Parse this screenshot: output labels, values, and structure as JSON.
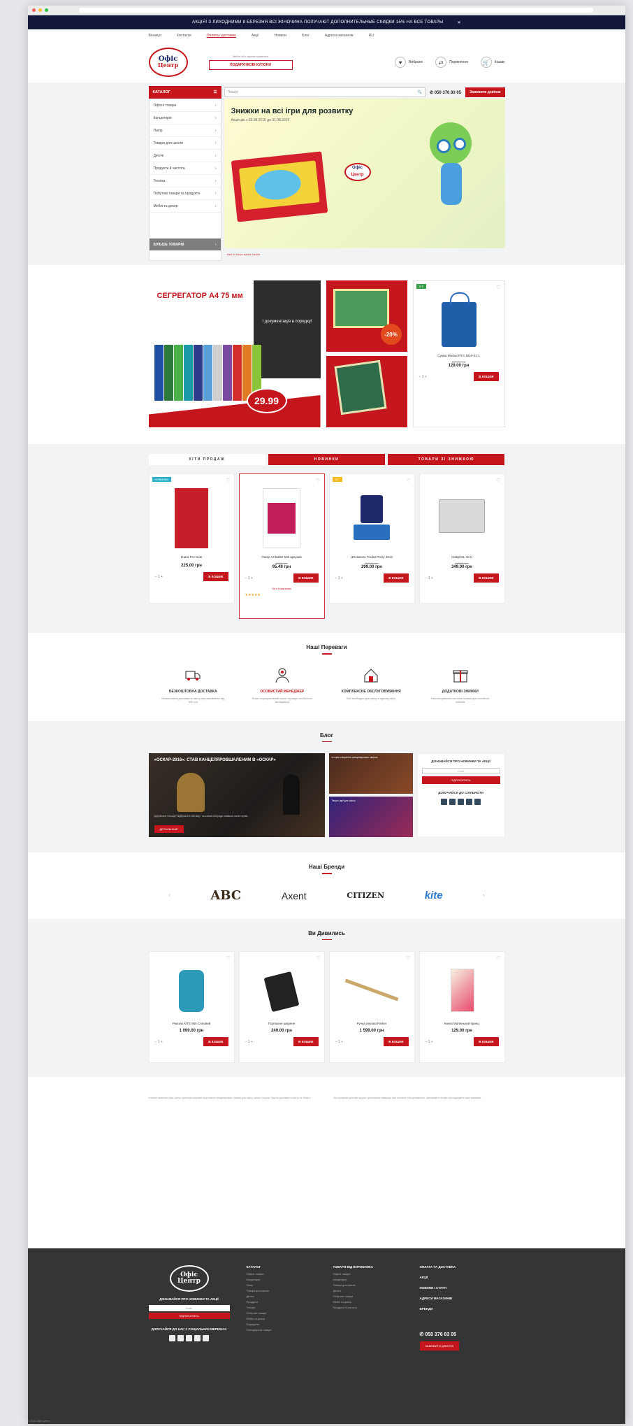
{
  "promo": {
    "text": "АКЦІЯ! З ЛИХОДНИМИ 8 БЕРЕЗНЯ ВСІ ЖІНОЧИНА ПОЛУЧАЮТ ДОПОЛНИТЕЛЬНЫЕ СКИДКИ 15% НА ВСЕ ТОВАРЫ",
    "close": "✕"
  },
  "topnav": {
    "items": [
      "Вінниця",
      "Контакти",
      "Оплата і доставка",
      "Акції",
      "Новини",
      "Блог",
      "Адреси магазинів",
      "RU"
    ]
  },
  "header": {
    "logo_top": "Офіс",
    "logo_bottom": "Центр",
    "signin_hint": "Увійти або зареєструватися",
    "signin_btn": "ПОДАРУНКОВІ КУПОНИ",
    "icons": [
      {
        "icon": "heart-icon",
        "label": "Вибране"
      },
      {
        "icon": "compare-icon",
        "label": "Порівняння"
      },
      {
        "icon": "cart-icon",
        "label": "Кошик"
      }
    ]
  },
  "search": {
    "catalog_label": "КАТАЛОГ",
    "placeholder": "Пошук",
    "phone": "050 376 83 05",
    "callback": "Замовити дзвінок"
  },
  "catalog": {
    "items": [
      "Офісні товари",
      "Канцелярія",
      "Папір",
      "Товари для школи",
      "Дитячі",
      "Продукти й чистота",
      "Техніка",
      "Побутові товари та продукти",
      "Меблі та декор"
    ],
    "cta": "БІЛЬШЕ ТОВАРІВ"
  },
  "hero": {
    "title": "Знижки на всі ігри для розвитку",
    "subtitle": "Акція діє з 03.08.2016 до 31.08.2016",
    "dots": "••••• •• •••••• ••••••• •••••••"
  },
  "banners": {
    "big_title": "СЕГРЕГАТОР А4 75 мм",
    "big_text": "І документація в порядку!",
    "big_price": "29.99",
    "discount": "-20%",
    "side_tag": "ХІТ",
    "side_name": "Сумка Фіксіки RTS 1910-01-1",
    "side_old": "155.00 грн",
    "side_price": "129.00 грн",
    "buy": "В КОШИК"
  },
  "tabs": [
    "ХІТИ ПРОДАЖ",
    "НОВИНКИ",
    "ТОВАРИ ЗІ ЗНИЖКОЮ"
  ],
  "products": [
    {
      "tag": "НОВИНКА",
      "name": "Книга Pro Note",
      "old": "",
      "price": "225.00 грн",
      "buy": "В КОШИК"
    },
    {
      "tag": "",
      "name": "Папір A4 Ballet 500 аркушів",
      "old": "89.00 грн",
      "price": "95.49 грн",
      "buy": "В КОШИК",
      "note": "Чи є в магазині",
      "rating": "★★★★★"
    },
    {
      "tag": "ХІТ",
      "name": "Штемпель Trodat Printy 4913",
      "old": "369.00 грн",
      "price": "299.00 грн",
      "buy": "В КОШИК"
    },
    {
      "tag": "",
      "name": "Сейф ML-30 K",
      "old": "405.00 грн",
      "price": "349.00 грн",
      "buy": "В КОШИК"
    }
  ],
  "advantages": {
    "title": "Наші Переваги",
    "items": [
      {
        "icon": "truck-icon",
        "title": "БЕЗКОШТОВНА ДОСТАВКА",
        "text": "Безкоштовна доставка по місту при замовленні від 500 грн"
      },
      {
        "icon": "manager-icon",
        "title": "ОСОБИСТИЙ МЕНЕДЖЕР",
        "text": "Кожен корпоративний клієнт отримує особистого менеджера"
      },
      {
        "icon": "service-icon",
        "title": "КОМПЛЕКСНЕ ОБСЛУГОВУВАННЯ",
        "text": "Все необхідне для офісу в одному місці"
      },
      {
        "icon": "gift-icon",
        "title": "ДОДАТКОВІ ЗНИЖКИ",
        "text": "Накопичувальна система знижок для постійних клієнтів"
      }
    ]
  },
  "blog": {
    "title": "Блог",
    "main_title": "«ОСКАР-2016»: СТАВ КАНЦЕЛЯРОВШАЛЕНИМ В «ОСКАР»",
    "main_text": "Церемонія «Оскар» відбулася в лютому, і ось вона нагорода знайшла своїх героїв.",
    "read_more": "ДЕТАЛЬНІШЕ",
    "side1": "Історія створення канцелярських скріпок",
    "side2": "Творчі ідеї для офісу",
    "sub_title": "ДІЗНАВАЙСЯ ПРО НОВИНКИ ТА АКЦІЇ",
    "sub_input": "Email",
    "sub_btn": "ПІДПИСАТИСЬ",
    "social_title": "ДОЛУЧАЙСЯ ДО СПІЛЬНОТИ"
  },
  "brands": {
    "title": "Наші Бренди",
    "items": [
      "ABC",
      "Axent",
      "CITIZEN",
      "kite"
    ]
  },
  "viewed": {
    "title": "Ви Дивились",
    "items": [
      {
        "name": "Рюкзак KITE 855 Сніговий",
        "price": "1 099.00 грн",
        "buy": "В КОШИК"
      },
      {
        "name": "Портмоне шкіряне",
        "price": "249.00 грн",
        "buy": "В КОШИК"
      },
      {
        "name": "Ручка перова Parker",
        "price": "1 599.00 грн",
        "buy": "В КОШИК"
      },
      {
        "name": "Книга Маленький принц",
        "price": "129.00 грн",
        "buy": "В КОШИК"
      }
    ]
  },
  "seo": {
    "left": "Інтернет-магазин Офіс Центр пропонує широкий асортимент канцелярських товарів для офісу, школи та дому. Зручна доставка по місту та області.",
    "right": "Ми працюємо для вас щодня, пропонуючи найкращі ціни та якісне обслуговування. Замовляйте онлайн або відвідайте наші магазини."
  },
  "footer": {
    "logo_top": "Офіс",
    "logo_bottom": "Центр",
    "sub_title": "ДІЗНАВАЙСЯ ПРО НОВИНКИ ТА АКЦІЇ",
    "sub_input": "Email",
    "sub_btn": "ПІДПИСАТИСЬ",
    "join": "ДОЛУЧАЙСЯ ДО НАС У СОЦІАЛЬНИХ МЕРЕЖАХ",
    "col1_title": "КАТАЛОГ",
    "col1": [
      "Офісні товари",
      "Канцелярія",
      "Папір",
      "Товари для школи",
      "Дитячі",
      "Продукти",
      "Техніка",
      "Побутові товари",
      "Меблі та декор",
      "Подарунки",
      "Господарські товари"
    ],
    "col2_title": "ТОВАРИ ВІД ВИРОБНИКА",
    "col2": [
      "Офісні товари",
      "Канцелярія",
      "Товари для школи",
      "Дитячі",
      "Побутові товари",
      "Меблі та декор",
      "Продукти й чистота"
    ],
    "col3_title": "ОПЛАТА ТА ДОСТАВКА",
    "col3": [
      "АКЦІЇ",
      "НОВИНИ І СТАТТІ",
      "АДРЕСИ МАГАЗИНІВ",
      "БРЕНДИ"
    ],
    "phone": "050 376 83 05",
    "callback": "ЗАМОВИТИ ДЗВІНОК"
  },
  "copyright": "© 2016 Офіс Центр"
}
